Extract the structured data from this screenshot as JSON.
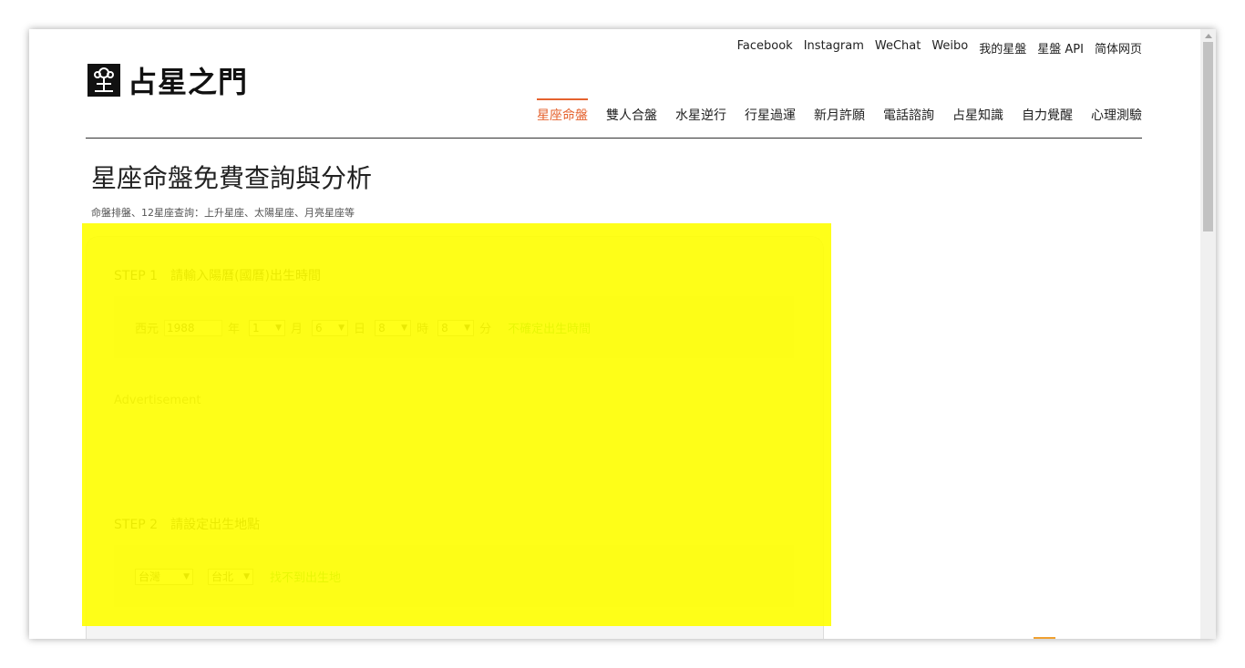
{
  "top_links": [
    "Facebook",
    "Instagram",
    "WeChat",
    "Weibo",
    "我的星盤",
    "星盤 API",
    "简体网页"
  ],
  "logo": {
    "text": "占星之門"
  },
  "main_nav": [
    {
      "label": "星座命盤",
      "active": true
    },
    {
      "label": "雙人合盤",
      "active": false
    },
    {
      "label": "水星逆行",
      "active": false
    },
    {
      "label": "行星過運",
      "active": false
    },
    {
      "label": "新月許願",
      "active": false
    },
    {
      "label": "電話諮詢",
      "active": false
    },
    {
      "label": "占星知識",
      "active": false
    },
    {
      "label": "自力覺醒",
      "active": false
    },
    {
      "label": "心理測驗",
      "active": false
    }
  ],
  "page": {
    "title": "星座命盤免費查詢與分析",
    "subtitle": "命盤排盤、12星座查詢：上升星座、太陽星座、月亮星座等"
  },
  "step1": {
    "num": "STEP 1",
    "label": "請輸入陽曆(國曆)出生時間",
    "era_label": "西元",
    "year_value": "1988",
    "year_unit": "年",
    "month_value": "1",
    "month_unit": "月",
    "day_value": "6",
    "day_unit": "日",
    "hour_value": "8",
    "hour_unit": "時",
    "minute_value": "8",
    "minute_unit": "分",
    "unsure_link": "不確定出生時間"
  },
  "ad_label": "Advertisement",
  "step2": {
    "num": "STEP 2",
    "label": "請設定出生地點",
    "country_value": "台灣",
    "city_value": "台北",
    "not_found_link": "找不到出生地"
  },
  "colors": {
    "accent": "#e5622e",
    "link_green": "#1a9e3a",
    "highlight": "#ffff00"
  }
}
